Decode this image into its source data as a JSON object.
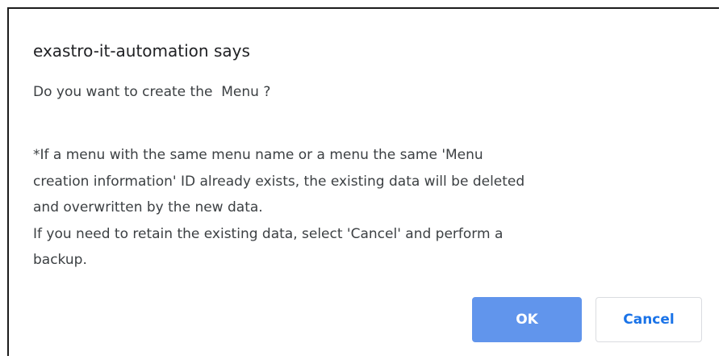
{
  "dialog": {
    "title": "exastro-it-automation says",
    "question": "Do you want to create the  Menu ?",
    "body_lines": [
      "*If a menu with the same menu name or a menu the same 'Menu",
      "creation information' ID already exists, the existing data will be deleted",
      "and overwritten by the new data.",
      "If you need to retain the existing data, select 'Cancel' and perform a",
      "backup."
    ],
    "ok_label": "OK",
    "cancel_label": "Cancel"
  },
  "colors": {
    "ok_background": "#6195ec",
    "cancel_text": "#1a73e8"
  }
}
